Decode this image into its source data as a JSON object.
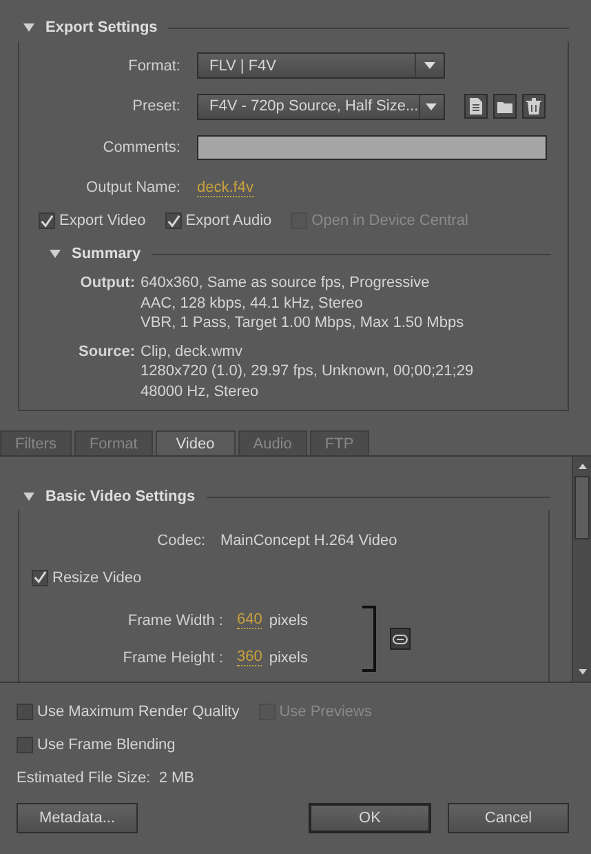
{
  "export_settings": {
    "title": "Export Settings",
    "expanded": true,
    "format": {
      "label": "Format:",
      "value": "FLV | F4V"
    },
    "preset": {
      "label": "Preset:",
      "value": "F4V - 720p Source, Half Size..."
    },
    "comments": {
      "label": "Comments:"
    },
    "output_name": {
      "label": "Output Name:",
      "value": "deck.f4v"
    },
    "checkboxes": [
      {
        "label": "Export Video",
        "checked": true,
        "disabled": false
      },
      {
        "label": "Export Audio",
        "checked": true,
        "disabled": false
      },
      {
        "label": "Open in Device Central",
        "checked": false,
        "disabled": true
      }
    ],
    "summary": {
      "title": "Summary",
      "expanded": true,
      "entries": [
        {
          "label": "Output:",
          "lines": [
            "640x360, Same as source fps, Progressive",
            "AAC, 128 kbps, 44.1 kHz, Stereo",
            "VBR, 1 Pass, Target 1.00 Mbps, Max 1.50 Mbps"
          ]
        },
        {
          "label": "Source:",
          "lines": [
            "Clip, deck.wmv",
            "1280x720 (1.0), 29.97 fps, Unknown, 00;00;21;29",
            "48000 Hz, Stereo"
          ]
        }
      ]
    }
  },
  "tabs": [
    {
      "label": "Filters",
      "selected": false
    },
    {
      "label": "Format",
      "selected": false
    },
    {
      "label": "Video",
      "selected": true
    },
    {
      "label": "Audio",
      "selected": false
    },
    {
      "label": "FTP",
      "selected": false
    }
  ],
  "video_settings": {
    "title": "Basic Video Settings",
    "expanded": true,
    "codec": {
      "label": "Codec:",
      "value": "MainConcept H.264 Video"
    },
    "resize": {
      "label": "Resize Video",
      "checked": true
    },
    "frame_size": [
      {
        "label": "Frame Width :",
        "value": "640",
        "unit": "pixels"
      },
      {
        "label": "Frame Height :",
        "value": "360",
        "unit": "pixels"
      }
    ]
  },
  "options": [
    {
      "label": "Use Maximum Render Quality",
      "checked": false,
      "disabled": false
    },
    {
      "label": "Use Previews",
      "checked": false,
      "disabled": true
    },
    {
      "label": "Use Frame Blending",
      "checked": false,
      "disabled": false
    }
  ],
  "file_size": {
    "label": "Estimated File Size:",
    "value": "2 MB"
  },
  "buttons": [
    {
      "label": "Metadata...",
      "kind": "secondary"
    },
    {
      "label": "OK",
      "kind": "default"
    },
    {
      "label": "Cancel",
      "kind": "secondary"
    }
  ]
}
